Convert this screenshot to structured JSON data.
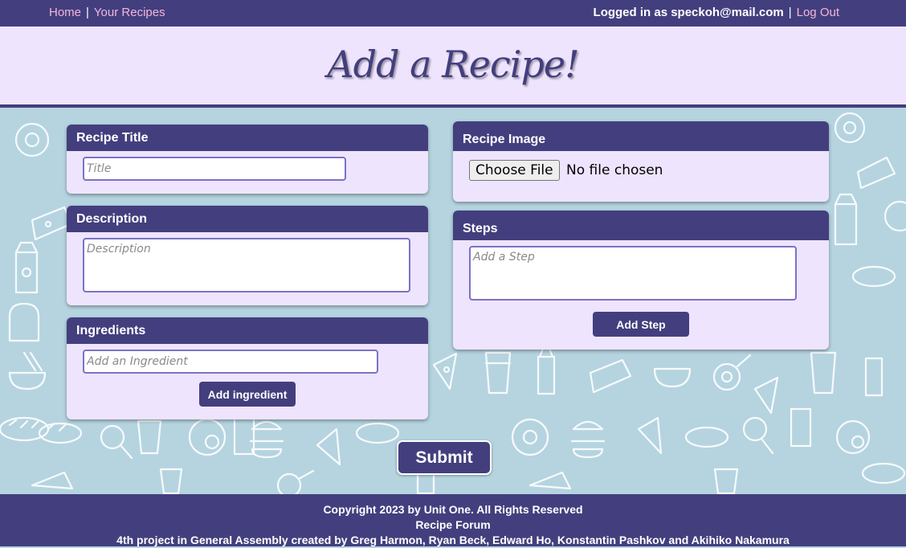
{
  "nav": {
    "home": "Home",
    "sep1": "|",
    "your_recipes": "Your Recipes",
    "logged_in": "Logged in as speckoh@mail.com",
    "sep2": "|",
    "logout": "Log Out"
  },
  "header": {
    "title": "Add a Recipe!"
  },
  "recipe_title": {
    "label": "Recipe Title",
    "placeholder": "Title",
    "value": ""
  },
  "description": {
    "label": "Description",
    "placeholder": "Description",
    "value": ""
  },
  "ingredients": {
    "label": "Ingredients",
    "placeholder": "Add an Ingredient",
    "value": "",
    "button": "Add ingredient"
  },
  "image": {
    "label": "Recipe Image",
    "button": "Choose File",
    "status": "No file chosen"
  },
  "steps": {
    "label": "Steps",
    "placeholder": "Add a Step",
    "value": "",
    "button": "Add Step"
  },
  "submit": "Submit",
  "footer": {
    "line1": "Copyright 2023 by Unit One. All Rights Reserved",
    "line2": "Recipe Forum",
    "line3": "4th project in General Assembly created by Greg Harmon, Ryan Beck, Edward Ho, Konstantin Pashkov and Akihiko Nakamura"
  },
  "colors": {
    "primary": "#433f7e",
    "panel": "#eee4fd",
    "background": "#b5d4e0",
    "link": "#f3b6da",
    "input_border": "#7b72c5"
  }
}
